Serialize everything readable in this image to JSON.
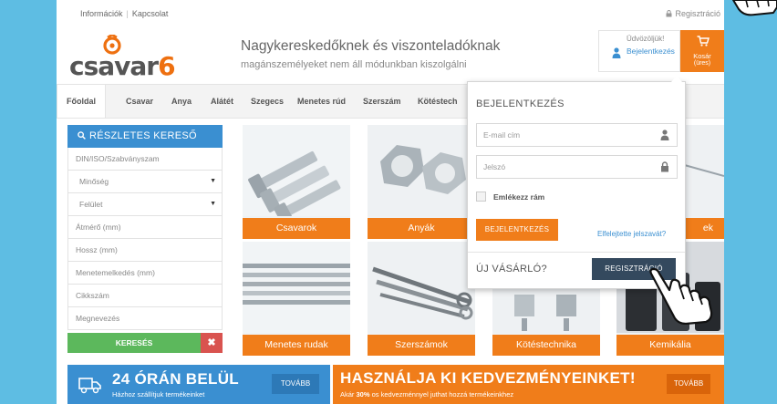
{
  "topbar": {
    "info": "Információk",
    "contact": "Kapcsolat",
    "register": "Regisztráció"
  },
  "logo": {
    "text_dark": "csavar",
    "text_accent": "6"
  },
  "tagline": {
    "line1": "Nagykereskedőknek és viszonteladóknak",
    "line2": "magánszemélyeket nem áll módunkban kiszolgálni"
  },
  "welcome": {
    "greeting": "Üdvözöljük!",
    "login_link": "Bejelentkezés"
  },
  "cart": {
    "label": "Kosár",
    "status": "(üres)"
  },
  "nav": [
    "Főoldal",
    "Csavar",
    "Anya",
    "Alátét",
    "Szegecs",
    "Menetes rúd",
    "Szerszám",
    "Kötéstech"
  ],
  "search": {
    "title": "RÉSZLETES KERESŐ",
    "din": "DIN/ISO/Szabványszam",
    "quality": "Minőség",
    "surface": "Felület",
    "diameter": "Átmérő (mm)",
    "length": "Hossz (mm)",
    "thread": "Menetemelkedés (mm)",
    "sku": "Cikkszám",
    "name": "Megnevezés",
    "submit": "KERESÉS",
    "clear": "✖"
  },
  "tiles": {
    "bolts": "Csavarok",
    "nuts": "Anyák",
    "washers_suffix": "ek",
    "rods": "Menetes rudak",
    "tools": "Szerszámok",
    "fixings": "Kötéstechnika",
    "chemicals": "Kemikália"
  },
  "login": {
    "title": "BEJELENTKEZÉS",
    "email_placeholder": "E-mail cím",
    "password_placeholder": "Jelszó",
    "remember": "Emlékezz rám",
    "login_button": "BEJELENTKEZÉS",
    "forgot": "Elfelejtette jelszavát?",
    "new_customer": "ÚJ VÁSÁRLÓ?",
    "register_button": "REGISZTRÁCIÓ"
  },
  "promo_delivery": {
    "title": "24 ÓRÁN BELÜL",
    "subtitle": "Házhoz szállítjuk termékeinket",
    "more": "TOVÁBB"
  },
  "promo_discount": {
    "title": "HASZNÁLJA KI KEDVEZMÉNYEINKET!",
    "subtitle_pre": "Akár ",
    "subtitle_bold": "30%",
    "subtitle_post": " os kedvezménnyel juthat hozzá termékeinkhez",
    "more": "TOVÁBB"
  },
  "colors": {
    "accent": "#f07d1a",
    "blue": "#3a8fd1",
    "background": "#5ebde3",
    "green": "#5cb85c",
    "red": "#d9534f",
    "dark": "#34495e"
  }
}
